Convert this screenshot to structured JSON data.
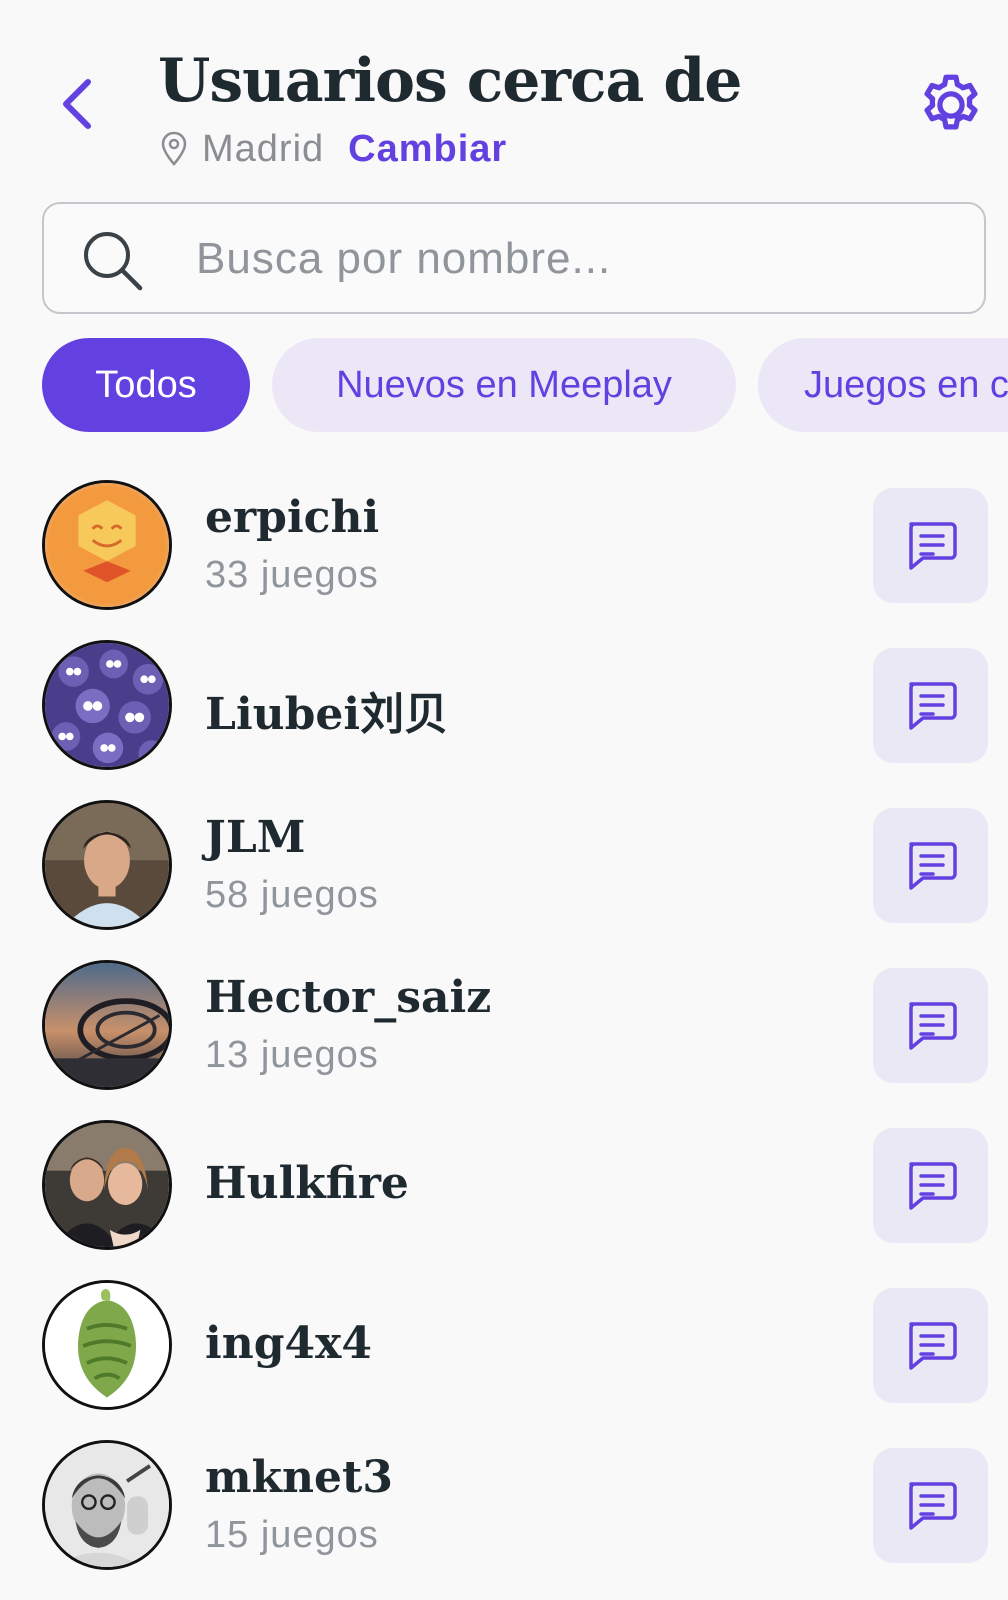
{
  "header": {
    "title": "Usuarios cerca de",
    "location_city": "Madrid",
    "change_label": "Cambiar"
  },
  "search": {
    "placeholder": "Busca por nombre..."
  },
  "filters": [
    {
      "label": "Todos",
      "active": true
    },
    {
      "label": "Nuevos en Meeplay",
      "active": false
    },
    {
      "label": "Juegos en c",
      "active": false
    }
  ],
  "users": [
    {
      "name": "erpichi",
      "games": "33 juegos"
    },
    {
      "name": "Liubei刘贝",
      "games": ""
    },
    {
      "name": "JLM",
      "games": "58 juegos"
    },
    {
      "name": "Hector_saiz",
      "games": "13 juegos"
    },
    {
      "name": "Hulkfire",
      "games": ""
    },
    {
      "name": "ing4x4",
      "games": ""
    },
    {
      "name": "mknet3",
      "games": "15 juegos"
    }
  ],
  "colors": {
    "accent": "#6340e0",
    "chip_inactive_bg": "#ebe7f7",
    "button_bg": "#ebe8f5",
    "background": "#f9f9fa",
    "text_primary": "#1f2a30",
    "text_secondary": "#8f959b"
  },
  "icons": {
    "back": "chevron-left-icon",
    "settings": "gear-icon",
    "location": "map-pin-icon",
    "search": "search-icon",
    "message": "message-icon"
  }
}
